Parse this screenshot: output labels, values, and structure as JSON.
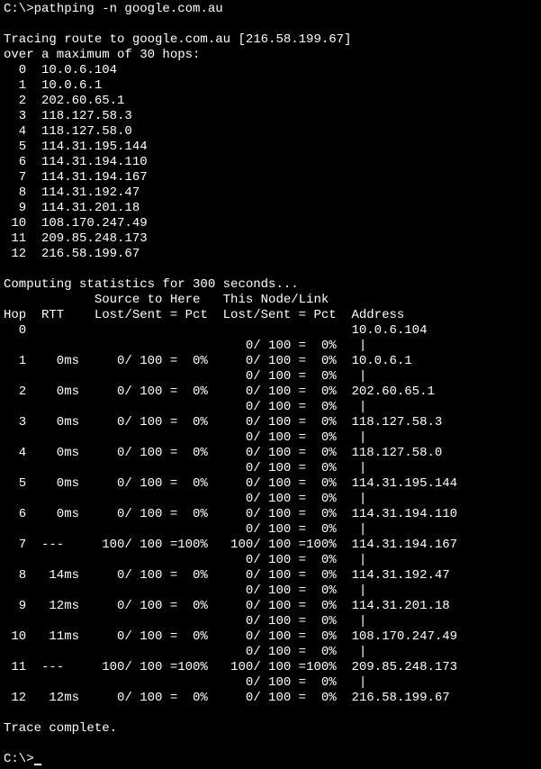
{
  "prompt1": "C:\\>",
  "command": "pathping -n google.com.au",
  "blank": "",
  "tracing_line": "Tracing route to google.com.au [216.58.199.67]",
  "over_line": "over a maximum of 30 hops:",
  "route_hops": [
    "  0  10.0.6.104",
    "  1  10.0.6.1",
    "  2  202.60.65.1",
    "  3  118.127.58.3",
    "  4  118.127.58.0",
    "  5  114.31.195.144",
    "  6  114.31.194.110",
    "  7  114.31.194.167",
    "  8  114.31.192.47",
    "  9  114.31.201.18",
    " 10  108.170.247.49",
    " 11  209.85.248.173",
    " 12  216.58.199.67"
  ],
  "computing_line": "Computing statistics for 300 seconds...",
  "header1": "            Source to Here   This Node/Link",
  "header2": "Hop  RTT    Lost/Sent = Pct  Lost/Sent = Pct  Address",
  "stats_lines": [
    "  0                                           10.0.6.104",
    "                                0/ 100 =  0%   |",
    "  1    0ms     0/ 100 =  0%     0/ 100 =  0%  10.0.6.1",
    "                                0/ 100 =  0%   |",
    "  2    0ms     0/ 100 =  0%     0/ 100 =  0%  202.60.65.1",
    "                                0/ 100 =  0%   |",
    "  3    0ms     0/ 100 =  0%     0/ 100 =  0%  118.127.58.3",
    "                                0/ 100 =  0%   |",
    "  4    0ms     0/ 100 =  0%     0/ 100 =  0%  118.127.58.0",
    "                                0/ 100 =  0%   |",
    "  5    0ms     0/ 100 =  0%     0/ 100 =  0%  114.31.195.144",
    "                                0/ 100 =  0%   |",
    "  6    0ms     0/ 100 =  0%     0/ 100 =  0%  114.31.194.110",
    "                                0/ 100 =  0%   |",
    "  7  ---     100/ 100 =100%   100/ 100 =100%  114.31.194.167",
    "                                0/ 100 =  0%   |",
    "  8   14ms     0/ 100 =  0%     0/ 100 =  0%  114.31.192.47",
    "                                0/ 100 =  0%   |",
    "  9   12ms     0/ 100 =  0%     0/ 100 =  0%  114.31.201.18",
    "                                0/ 100 =  0%   |",
    " 10   11ms     0/ 100 =  0%     0/ 100 =  0%  108.170.247.49",
    "                                0/ 100 =  0%   |",
    " 11  ---     100/ 100 =100%   100/ 100 =100%  209.85.248.173",
    "                                0/ 100 =  0%   |",
    " 12   12ms     0/ 100 =  0%     0/ 100 =  0%  216.58.199.67"
  ],
  "trace_complete": "Trace complete.",
  "prompt2": "C:\\>"
}
